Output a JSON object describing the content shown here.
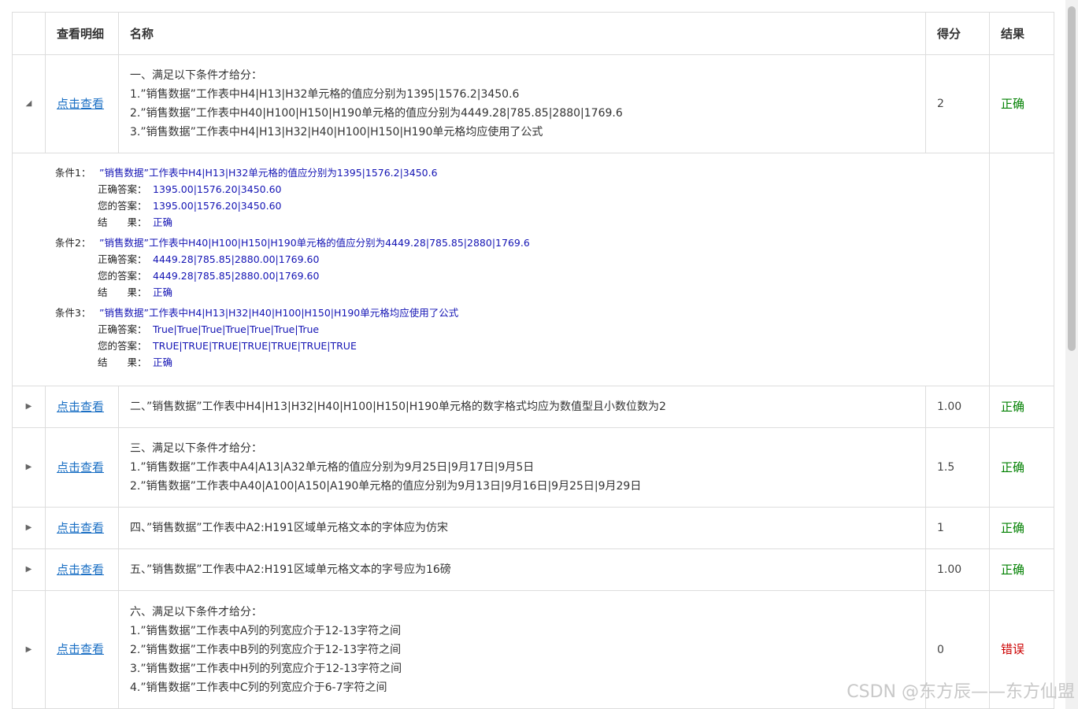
{
  "header": {
    "view_detail": "查看明细",
    "name": "名称",
    "score": "得分",
    "result": "结果"
  },
  "rows": [
    {
      "link": "点击查看",
      "lines": [
        "一、满足以下条件才给分：",
        "1.”销售数据”工作表中H4|H13|H32单元格的值应分别为1395|1576.2|3450.6",
        "2.”销售数据”工作表中H40|H100|H150|H190单元格的值应分别为4449.28|785.85|2880|1769.6",
        "3.”销售数据”工作表中H4|H13|H32|H40|H100|H150|H190单元格均应使用了公式"
      ],
      "score": "2",
      "result": "正确"
    },
    {
      "link": "点击查看",
      "lines": [
        "二、”销售数据”工作表中H4|H13|H32|H40|H100|H150|H190单元格的数字格式均应为数值型且小数位数为2"
      ],
      "score": "1.00",
      "result": "正确"
    },
    {
      "link": "点击查看",
      "lines": [
        "三、满足以下条件才给分：",
        "1.”销售数据”工作表中A4|A13|A32单元格的值应分别为9月25日|9月17日|9月5日",
        "2.”销售数据”工作表中A40|A100|A150|A190单元格的值应分别为9月13日|9月16日|9月25日|9月29日"
      ],
      "score": "1.5",
      "result": "正确"
    },
    {
      "link": "点击查看",
      "lines": [
        "四、”销售数据”工作表中A2:H191区域单元格文本的字体应为仿宋"
      ],
      "score": "1",
      "result": "正确"
    },
    {
      "link": "点击查看",
      "lines": [
        "五、”销售数据”工作表中A2:H191区域单元格文本的字号应为16磅"
      ],
      "score": "1.00",
      "result": "正确"
    },
    {
      "link": "点击查看",
      "lines": [
        "六、满足以下条件才给分：",
        "1.”销售数据”工作表中A列的列宽应介于12-13字符之间",
        "2.”销售数据”工作表中B列的列宽应介于12-13字符之间",
        "3.”销售数据”工作表中H列的列宽应介于12-13字符之间",
        "4.”销售数据”工作表中C列的列宽应介于6-7字符之间"
      ],
      "score": "0",
      "result": "错误"
    }
  ],
  "detail": {
    "labels": {
      "correct": "正确答案：",
      "yours": "您的答案：",
      "result": "结　　果："
    },
    "conditions": [
      {
        "label": "条件1：",
        "desc": "”销售数据”工作表中H4|H13|H32单元格的值应分别为1395|1576.2|3450.6",
        "correct": "1395.00|1576.20|3450.60",
        "yours": "1395.00|1576.20|3450.60",
        "result": "正确"
      },
      {
        "label": "条件2：",
        "desc": "”销售数据”工作表中H40|H100|H150|H190单元格的值应分别为4449.28|785.85|2880|1769.6",
        "correct": "4449.28|785.85|2880.00|1769.60",
        "yours": "4449.28|785.85|2880.00|1769.60",
        "result": "正确"
      },
      {
        "label": "条件3：",
        "desc": "”销售数据”工作表中H4|H13|H32|H40|H100|H150|H190单元格均应使用了公式",
        "correct": "True|True|True|True|True|True|True",
        "yours": "TRUE|TRUE|TRUE|TRUE|TRUE|TRUE|TRUE",
        "result": "正确"
      }
    ]
  },
  "icons": {
    "expanded": "caret-down-icon",
    "collapsed": "caret-right-icon"
  },
  "colors": {
    "link": "#1a6fc4",
    "ok": "#008000",
    "bad": "#cc0000",
    "detail_blue": "#1414b4"
  },
  "watermark": "CSDN @东方辰——东方仙盟"
}
